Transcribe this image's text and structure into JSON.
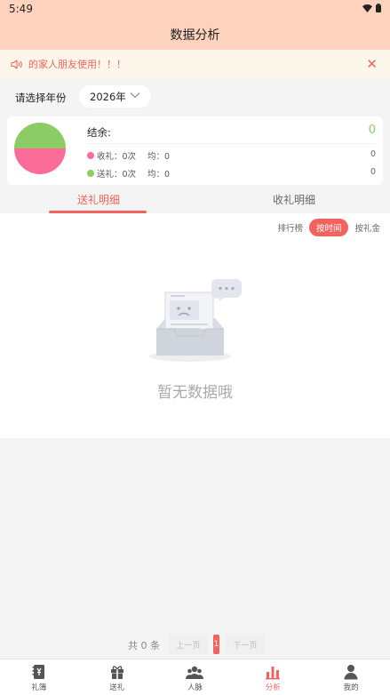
{
  "status_bar": {
    "time": "5:49"
  },
  "header": {
    "title": "数据分析"
  },
  "notice": {
    "text": "的家人朋友使用！！！",
    "close": "✕"
  },
  "year_filter": {
    "label": "请选择年份",
    "value": "2026年"
  },
  "summary": {
    "balance_label": "结余:",
    "balance_value": "0",
    "received": {
      "label": "收礼：0次",
      "avg": "均：0",
      "total": "0"
    },
    "sent": {
      "label": "送礼：0次",
      "avg": "均：0",
      "total": "0"
    },
    "colors": {
      "received": "#fb6c99",
      "sent": "#8ccc64"
    }
  },
  "tabs": [
    {
      "label": "送礼明细",
      "active": true
    },
    {
      "label": "收礼明细",
      "active": false
    }
  ],
  "sort": {
    "options": [
      "排行榜",
      "按时间",
      "按礼金"
    ],
    "active": "按时间"
  },
  "empty_state": {
    "text": "暂无数据哦"
  },
  "pagination": {
    "total": "共 0 条",
    "prev": "上一页",
    "current": "1",
    "next": "下一页"
  },
  "bottom_nav": [
    {
      "label": "礼簿",
      "icon": "ledger-icon",
      "active": false
    },
    {
      "label": "送礼",
      "icon": "gift-icon",
      "active": false
    },
    {
      "label": "人脉",
      "icon": "contacts-icon",
      "active": false
    },
    {
      "label": "分析",
      "icon": "chart-icon",
      "active": true
    },
    {
      "label": "我的",
      "icon": "profile-icon",
      "active": false
    }
  ],
  "theme": {
    "accent": "#f0635e",
    "header_bg": "#fdd3bd",
    "positive": "#8ccc64"
  }
}
